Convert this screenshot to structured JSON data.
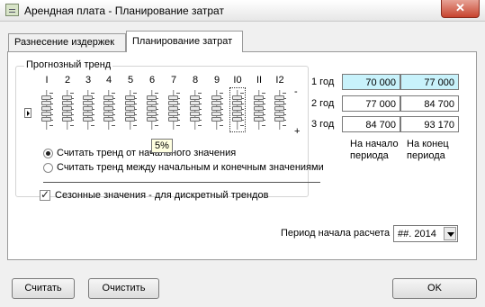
{
  "window": {
    "title": "Арендная плата - Планирование затрат",
    "close_label": "✕"
  },
  "tabs": [
    {
      "label": "Разнесение издержек",
      "active": false
    },
    {
      "label": "Планирование затрат",
      "active": true
    }
  ],
  "trend": {
    "group_label": "Прогнозный тренд",
    "columns": [
      "I",
      "2",
      "3",
      "4",
      "5",
      "6",
      "7",
      "8",
      "9",
      "I0",
      "II",
      "I2"
    ],
    "minus_label": "-",
    "plus_label": "+",
    "tooltip": "5%"
  },
  "options": {
    "radio_1": "Считать тренд от начального значения",
    "radio_2": "Считать тренд между начальным и конечным значениями",
    "radio_selected": 1,
    "seasonal_label": "Сезонные значения - для дискретный трендов",
    "seasonal_checked": true
  },
  "years": {
    "rows": [
      {
        "label": "1 год",
        "start": "70 000",
        "end": "77 000"
      },
      {
        "label": "2 год",
        "start": "77 000",
        "end": "84 700"
      },
      {
        "label": "3 год",
        "start": "84 700",
        "end": "93 170"
      }
    ],
    "col_start_header_1": "На начало",
    "col_start_header_2": "периода",
    "col_end_header_1": "На конец",
    "col_end_header_2": "периода"
  },
  "period": {
    "label": "Период начала расчета",
    "value": "##. 2014"
  },
  "buttons": {
    "calc": "Считать",
    "clear": "Очистить",
    "ok": "OK"
  },
  "colors": {
    "highlight_cell": "#c8f2fb",
    "tooltip_bg": "#ffffe1"
  }
}
